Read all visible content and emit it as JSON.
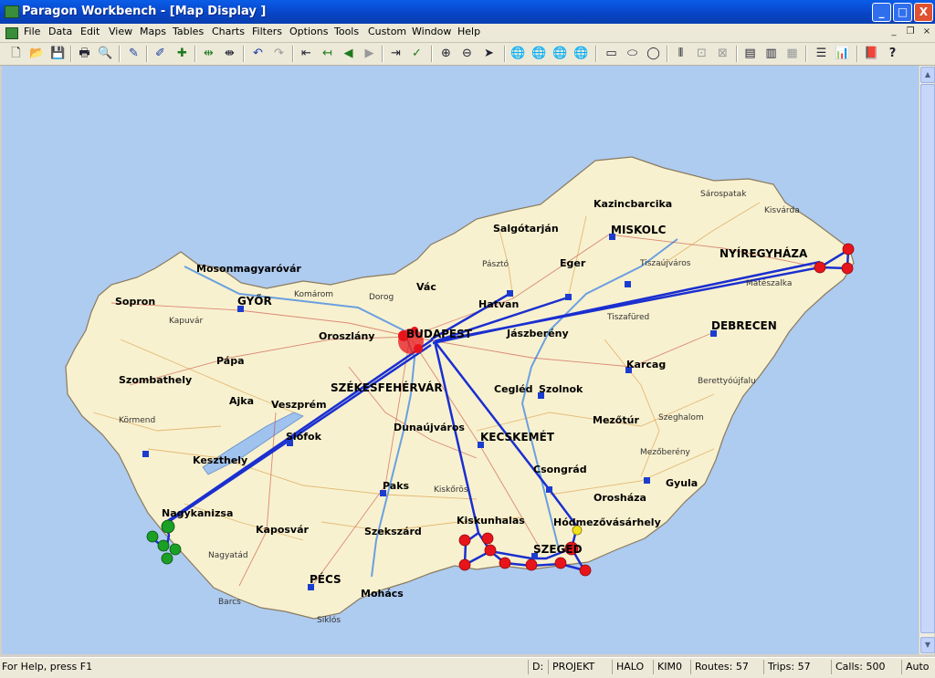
{
  "window": {
    "title": "Paragon Workbench - [Map Display ]",
    "buttons": {
      "minimize": "_",
      "maximize": "□",
      "close": "X"
    }
  },
  "menu": {
    "items": [
      "File",
      "Data",
      "Edit",
      "View",
      "Maps",
      "Tables",
      "Charts",
      "Filters",
      "Options",
      "Tools",
      "Custom",
      "Window",
      "Help"
    ],
    "mdi": {
      "minimize": "_",
      "restore": "❐",
      "close": "×"
    }
  },
  "toolbar": {
    "buttons": [
      {
        "name": "new-file-icon",
        "glyph": "🗋"
      },
      {
        "name": "open-folder-icon",
        "glyph": "📂"
      },
      {
        "name": "save-disk-icon",
        "glyph": "💾"
      },
      {
        "name": "print-icon",
        "glyph": "🖶"
      },
      {
        "name": "print-preview-icon",
        "glyph": "🔍"
      },
      {
        "name": "edit-route-icon",
        "glyph": "✎"
      },
      {
        "name": "edit-stops-icon",
        "glyph": "✐"
      },
      {
        "name": "add-stop-icon",
        "glyph": "✚"
      },
      {
        "name": "route-split-icon",
        "glyph": "⇹"
      },
      {
        "name": "route-merge-icon",
        "glyph": "⇼"
      },
      {
        "name": "undo-icon",
        "glyph": "↶"
      },
      {
        "name": "redo-icon",
        "glyph": "↷"
      },
      {
        "name": "route-first-icon",
        "glyph": "⇤"
      },
      {
        "name": "route-start-icon",
        "glyph": "↤"
      },
      {
        "name": "arrow-left-icon",
        "glyph": "◀"
      },
      {
        "name": "arrow-right-icon",
        "glyph": "▶"
      },
      {
        "name": "route-end-icon",
        "glyph": "⇥"
      },
      {
        "name": "route-check-icon",
        "glyph": "✓"
      },
      {
        "name": "zoom-in-icon",
        "glyph": "⊕"
      },
      {
        "name": "zoom-out-icon",
        "glyph": "⊖"
      },
      {
        "name": "pointer-icon",
        "glyph": "➤"
      },
      {
        "name": "globe-1-icon",
        "glyph": "🌐"
      },
      {
        "name": "globe-2-icon",
        "glyph": "🌐"
      },
      {
        "name": "globe-3-icon",
        "glyph": "🌐"
      },
      {
        "name": "globe-4-icon",
        "glyph": "🌐"
      },
      {
        "name": "select-rectangle-icon",
        "glyph": "▭"
      },
      {
        "name": "select-ellipse-icon",
        "glyph": "⬭"
      },
      {
        "name": "select-circle-icon",
        "glyph": "◯"
      },
      {
        "name": "select-bar-icon",
        "glyph": "⦀"
      },
      {
        "name": "select-point-icon",
        "glyph": "⊡"
      },
      {
        "name": "select-clear-icon",
        "glyph": "⊠"
      },
      {
        "name": "table-1-icon",
        "glyph": "▤"
      },
      {
        "name": "table-2-icon",
        "glyph": "▥"
      },
      {
        "name": "table-3-icon",
        "glyph": "▦"
      },
      {
        "name": "list-view-icon",
        "glyph": "☰"
      },
      {
        "name": "bar-chart-icon",
        "glyph": "📊"
      },
      {
        "name": "book-icon",
        "glyph": "📕"
      },
      {
        "name": "help-pointer-icon",
        "glyph": "?"
      }
    ]
  },
  "map": {
    "cities_major": [
      "BUDAPEST",
      "MISKOLC",
      "NYÍREGYHÁZA",
      "DEBRECEN",
      "GYŐR",
      "SZÉKESFEHÉRVÁR",
      "KECSKEMÉT",
      "SZEGED",
      "PÉCS"
    ],
    "cities": [
      "Kazincbarcika",
      "Salgótarján",
      "Eger",
      "Hatvan",
      "Vác",
      "Mosonmagyaróvár",
      "Sopron",
      "Oroszlány",
      "Jászberény",
      "Karcag",
      "Pápa",
      "Szombathely",
      "Ajka",
      "Veszprém",
      "Cegléd",
      "Szolnok",
      "Dunaújváros",
      "Mezőtúr",
      "Siófok",
      "Keszthely",
      "Csongrád",
      "Gyula",
      "Paks",
      "Orosháza",
      "Nagykanizsa",
      "Kiskunhalas",
      "Hódmezővásárhely",
      "Kaposvár",
      "Szekszárd",
      "Mohács"
    ],
    "towns": [
      "Sárospatak",
      "Kisvárda",
      "Mátészalka",
      "Tiszaújváros",
      "Pásztó",
      "Komárom",
      "Dorog",
      "Tiszafüred",
      "Kapuvár",
      "Berettyóújfalu",
      "Körmend",
      "Szeghalom",
      "Mezőberény",
      "Kiskőrös",
      "Nagyatád",
      "Barcs",
      "Siklós"
    ],
    "colors": {
      "water": "#aecbf0",
      "land": "#f8f1cf",
      "route": "#1a2fd0",
      "stop": "#e8141c",
      "depot": "#1aa025",
      "warehouse": "#1c3cd0"
    }
  },
  "status": {
    "help": "For Help, press F1",
    "drive": "D:",
    "project": "PROJEKT",
    "halo": "HALO",
    "kim": "KIM0",
    "routes": "Routes:  57",
    "trips": "Trips:  57",
    "calls": "Calls:  500",
    "mode": "Auto"
  }
}
